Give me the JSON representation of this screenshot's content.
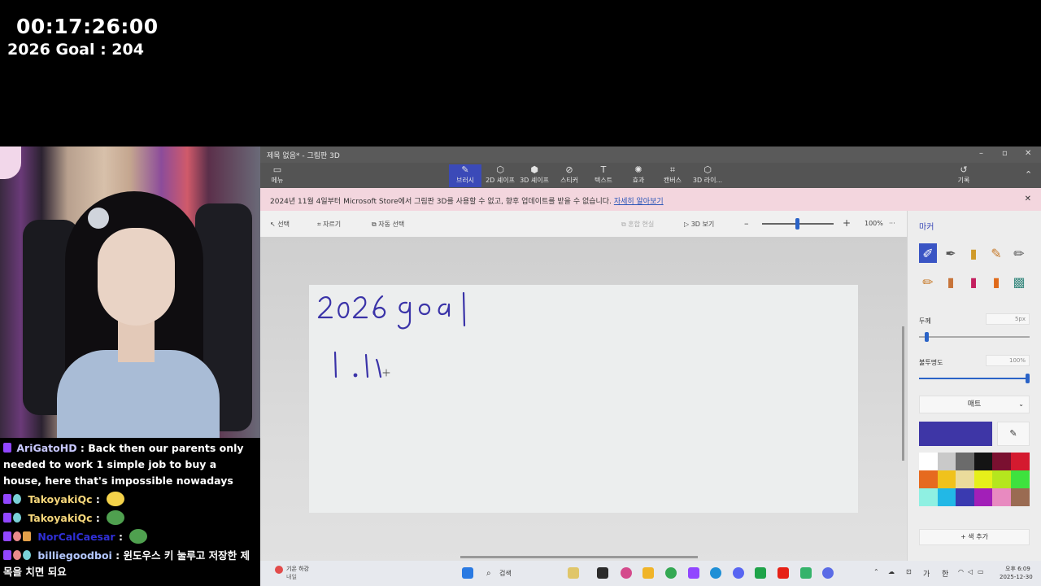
{
  "overlay": {
    "timer": "00:17:26:00",
    "goal": "2026 Goal : 204"
  },
  "chat": [
    {
      "user": "AriGatoHD",
      "user_color": "#c9c9ff",
      "message": " : Back then our parents only needed to work 1 simple job to buy a house, here that's impossible nowadays"
    },
    {
      "user": "TakoyakiQc",
      "user_color": "#f5d67a",
      "message": " : ",
      "emote_color": "#f4d24a"
    },
    {
      "user": "TakoyakiQc",
      "user_color": "#f5d67a",
      "message": " : ",
      "emote_color": "#4fa04f"
    },
    {
      "user": "NorCalCaesar",
      "user_color": "#2f2fd6",
      "message": " : ",
      "emote_color": "#4fa04f"
    },
    {
      "user": "billiegoodboi",
      "user_color": "#b4c8ff",
      "message": " : 윈도우스 키 눌루고 저장한 제목을 치면 되요"
    }
  ],
  "window": {
    "title": "제목 없음* - 그림판 3D",
    "controls": {
      "minimize": "–",
      "maximize": "▫",
      "close": "✕"
    },
    "menu_label": "메뉴",
    "ribbon": [
      {
        "label": "브러시",
        "icon": "✎",
        "active": true
      },
      {
        "label": "2D 셰이프",
        "icon": "⬡"
      },
      {
        "label": "3D 셰이프",
        "icon": "⬢"
      },
      {
        "label": "스티커",
        "icon": "⊘"
      },
      {
        "label": "텍스트",
        "icon": "T"
      },
      {
        "label": "효과",
        "icon": "✺"
      },
      {
        "label": "캔버스",
        "icon": "⌗"
      },
      {
        "label": "3D 라이...",
        "icon": "⬡"
      }
    ],
    "history_label": "기록",
    "notice": {
      "text": "2024년 11월 4일부터 Microsoft Store에서 그림판 3D를 사용할 수 없고, 향후 업데이트를 받을 수 없습니다.",
      "link": "자세히 알아보기"
    },
    "toolbar": {
      "select": "선택",
      "crop": "자르기",
      "magic_select": "자동 선택",
      "mixed_reality": "혼합 현실",
      "view3d": "3D 보기",
      "zoom": "100%",
      "more": "···"
    },
    "canvas_ink": {
      "line1": "2026 goal",
      "line2": "1.11"
    }
  },
  "panel": {
    "title": "마커",
    "thickness_label": "두께",
    "thickness_value": "5px",
    "thickness_level": 0.05,
    "opacity_label": "불투명도",
    "opacity_value": "100%",
    "opacity_level": 1.0,
    "finish": "매트",
    "current_color": "#3e36a6",
    "add_color": "+ 색 추가",
    "swatches": [
      "#ffffff",
      "#c9c9c9",
      "#6b6b6b",
      "#141414",
      "#7a1030",
      "#d41a2f",
      "#e66a1f",
      "#f0c21c",
      "#eadb9b",
      "#e6ef1a",
      "#b5e61e",
      "#3ee23e",
      "#8ff0e2",
      "#22b8e6",
      "#3a3ab0",
      "#a21fb8",
      "#e88ac0",
      "#9a6b52"
    ]
  },
  "taskbar": {
    "weather": "기온 하강",
    "weather_sub": "내일",
    "search": "검색",
    "ime": "가",
    "lang": "한",
    "time": "오후 6:09",
    "date": "2025-12-30"
  }
}
